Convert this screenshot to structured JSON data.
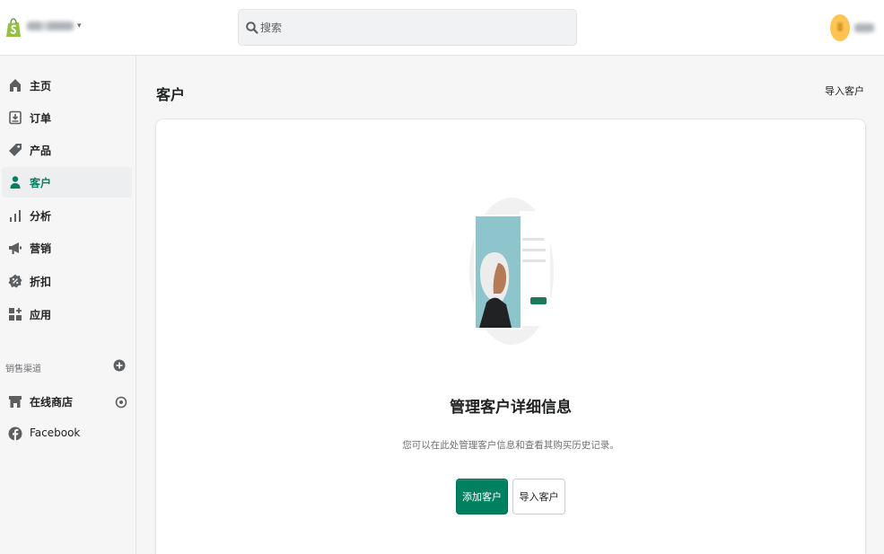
{
  "header": {
    "store_icon": "shopify-bag-icon",
    "search_placeholder": "搜索",
    "search_value": ""
  },
  "sidebar": {
    "items": [
      {
        "label": "主页",
        "icon": "home-icon"
      },
      {
        "label": "订单",
        "icon": "orders-icon"
      },
      {
        "label": "产品",
        "icon": "tag-icon"
      },
      {
        "label": "客户",
        "icon": "person-icon",
        "active": true
      },
      {
        "label": "分析",
        "icon": "bar-chart-icon"
      },
      {
        "label": "营销",
        "icon": "megaphone-icon"
      },
      {
        "label": "折扣",
        "icon": "discount-icon"
      },
      {
        "label": "应用",
        "icon": "apps-icon"
      }
    ],
    "sales_channels_title": "销售渠道",
    "channels": [
      {
        "label": "在线商店",
        "icon": "store-icon"
      },
      {
        "label": "Facebook",
        "icon": "facebook-icon"
      }
    ]
  },
  "main": {
    "title": "客户",
    "import_label": "导入客户",
    "empty_state": {
      "heading": "管理客户详细信息",
      "description": "您可以在此处管理客户信息和查看其购买历史记录。",
      "primary_button": "添加客户",
      "secondary_button": "导入客户"
    }
  },
  "colors": {
    "accent": "#008060",
    "text": "#202223",
    "subdued": "#6d7175",
    "background": "#f6f6f7"
  }
}
